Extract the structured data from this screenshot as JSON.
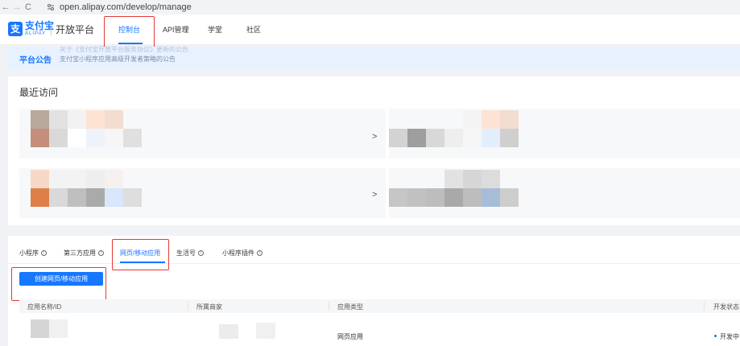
{
  "browser": {
    "back": "←",
    "forward": "→",
    "reload": "C",
    "url": "open.alipay.com/develop/manage"
  },
  "header": {
    "logo_mark": "支",
    "logo_text": "支付宝",
    "logo_sub": "ALIPAY",
    "platform": "开放平台",
    "nav": [
      {
        "label": "控制台",
        "active": true
      },
      {
        "label": "API管理",
        "active": false
      },
      {
        "label": "学堂",
        "active": false
      },
      {
        "label": "社区",
        "active": false
      }
    ]
  },
  "announcement": {
    "title": "平台公告",
    "line1": "关于《支付宝开放平台服务协议》更新的公告",
    "line2": "支付宝小程序应用高级开发者策略的公告"
  },
  "recent": {
    "title": "最近访问",
    "arrow": ">"
  },
  "apps": {
    "tabs": [
      {
        "label": "小程序",
        "info": "i",
        "active": false
      },
      {
        "label": "第三方应用",
        "info": "i",
        "active": false
      },
      {
        "label": "网页/移动应用",
        "active": true
      },
      {
        "label": "生活号",
        "info": "i",
        "active": false
      },
      {
        "label": "小程序插件",
        "info": "i",
        "active": false
      }
    ],
    "create_button": "创建网页/移动应用",
    "columns": [
      "应用名称/ID",
      "所属商家",
      "应用类型",
      "开发状态"
    ],
    "rows": [
      {
        "type": "网页应用",
        "status": "开发中"
      }
    ]
  },
  "colors": {
    "accent": "#1677ff",
    "highlight_box": "#e53935",
    "announcement_bg": "#e8f1ff"
  }
}
